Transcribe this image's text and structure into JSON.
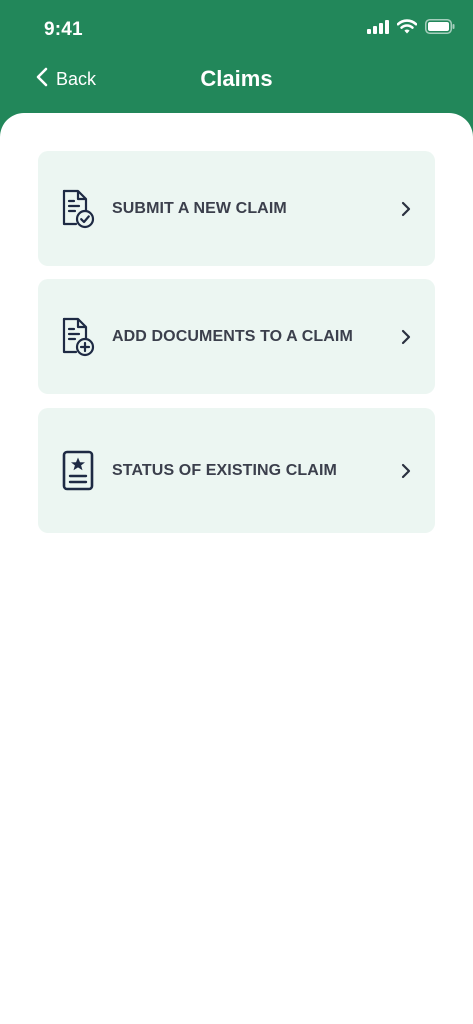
{
  "status_bar": {
    "time": "9:41",
    "icons": [
      "cellular-signal-icon",
      "wifi-icon",
      "battery-icon"
    ]
  },
  "nav": {
    "back_label": "Back",
    "title": "Claims"
  },
  "colors": {
    "header_green": "#22875a",
    "card_background": "#ecf6f2",
    "text_dark": "#3b3f4c",
    "icon_navy": "#1e2a44"
  },
  "menu": {
    "items": [
      {
        "label": "SUBMIT A NEW CLAIM",
        "icon": "document-check-icon"
      },
      {
        "label": "ADD DOCUMENTS TO A CLAIM",
        "icon": "document-add-icon"
      },
      {
        "label": "STATUS OF EXISTING CLAIM",
        "icon": "document-star-icon"
      }
    ]
  }
}
